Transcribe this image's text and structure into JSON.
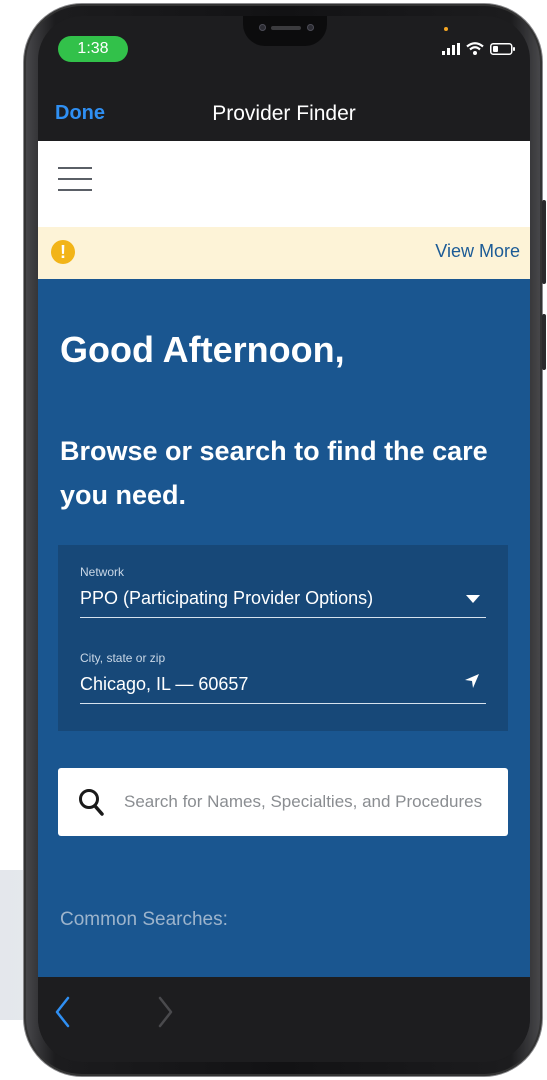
{
  "status_bar": {
    "time": "1:38",
    "icons": [
      "signal-icon",
      "wifi-icon",
      "battery-icon"
    ]
  },
  "nav": {
    "done_label": "Done",
    "title": "Provider Finder"
  },
  "alert": {
    "icon": "exclamation-icon",
    "icon_glyph": "!",
    "action_label": "View More"
  },
  "main": {
    "greeting": "Good Afternoon,",
    "subtitle": "Browse or search to find the care you need.",
    "network": {
      "label": "Network",
      "value": "PPO (Participating Provider Options)"
    },
    "location": {
      "label": "City, state or zip",
      "value": "Chicago, IL — 60657"
    },
    "search": {
      "placeholder": "Search for Names, Specialties, and Procedures"
    },
    "common_searches_label": "Common Searches:"
  },
  "bottom_nav": {
    "back_icon": "chevron-left-icon",
    "forward_icon": "chevron-right-icon"
  },
  "colors": {
    "accent_blue": "#2f8ff2",
    "main_blue": "#1a5690",
    "panel_blue": "#174878",
    "alert_bg": "#fdf3d7",
    "alert_icon": "#f2b418",
    "link_blue": "#1c5b96",
    "time_pill": "#32c14a"
  }
}
